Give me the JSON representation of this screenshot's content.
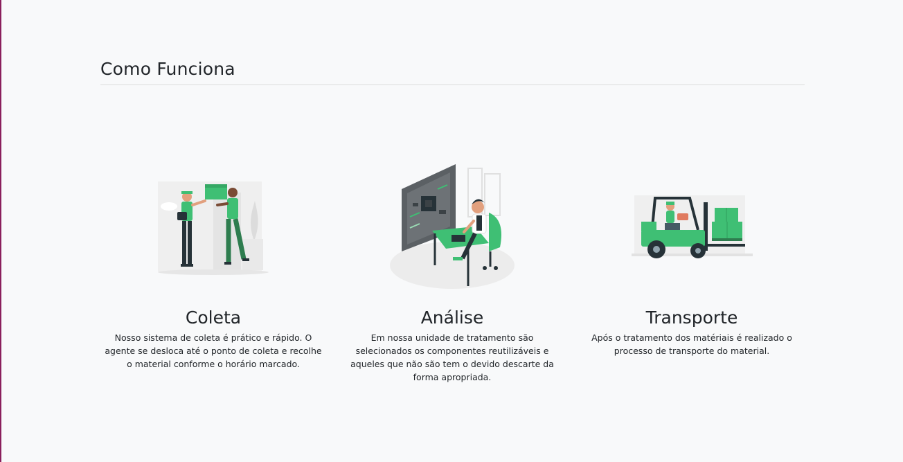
{
  "colors": {
    "background": "#f8f9fa",
    "text": "#212529",
    "accent_green": "#3fbf74",
    "dark_green": "#2e7d4f",
    "divider": "#dcdcdc"
  },
  "section": {
    "title": "Como Funciona"
  },
  "steps": [
    {
      "title": "Coleta",
      "description": "Nosso sistema de coleta é prático e rápido. O agente se desloca até o ponto de coleta e recolhe o material conforme o horário marcado.",
      "illustration": "delivery-people-icon"
    },
    {
      "title": "Análise",
      "description": "Em nossa unidade de tratamento são selecionados os componentes reutilizáveis e aqueles que não são tem o devido descarte da forma apropriada.",
      "illustration": "circuit-board-technician-icon"
    },
    {
      "title": "Transporte",
      "description": "Após o tratamento dos matériais é realizado o processo de transporte do material.",
      "illustration": "forklift-icon"
    }
  ]
}
